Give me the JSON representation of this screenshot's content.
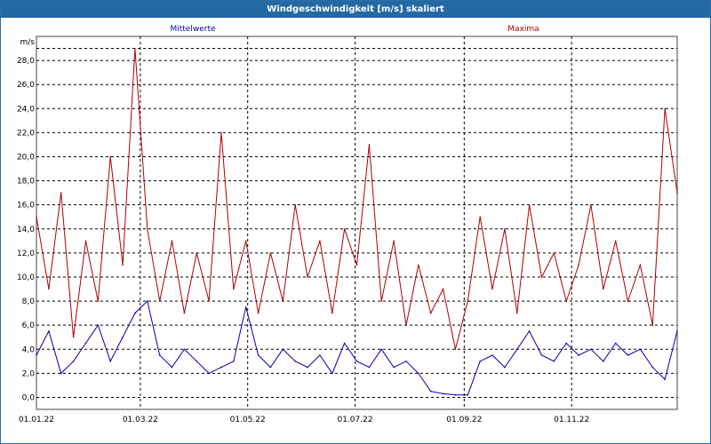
{
  "window": {
    "title": "Windgeschwindigkeit [m/s] skaliert"
  },
  "colors": {
    "mean": "#0000aa",
    "max": "#aa0000",
    "grid": "#000000",
    "title_bar": "#2369a3"
  },
  "chart_data": {
    "type": "line",
    "ylabel": "m/s",
    "ylim": [
      -1,
      30
    ],
    "yticks": [
      "0,0",
      "2,0",
      "4,0",
      "6,0",
      "8,0",
      "10,0",
      "12,0",
      "14,0",
      "16,0",
      "18,0",
      "20,0",
      "22,0",
      "24,0",
      "26,0",
      "28,0"
    ],
    "xlim": [
      "2022-01-01",
      "2022-12-31"
    ],
    "xticks": [
      "01.01.22",
      "01.03.22",
      "01.05.22",
      "01.07.22",
      "01.09.22",
      "01.11.22"
    ],
    "grid": true,
    "legend_placement": "top",
    "series": [
      {
        "name": "Mittelwerte",
        "color": "#0000aa",
        "x": [
          "2022-01-01",
          "2022-01-08",
          "2022-01-15",
          "2022-01-22",
          "2022-01-29",
          "2022-02-05",
          "2022-02-12",
          "2022-02-19",
          "2022-02-26",
          "2022-03-05",
          "2022-03-12",
          "2022-03-19",
          "2022-03-26",
          "2022-04-02",
          "2022-04-09",
          "2022-04-16",
          "2022-04-23",
          "2022-04-30",
          "2022-05-07",
          "2022-05-14",
          "2022-05-21",
          "2022-05-28",
          "2022-06-04",
          "2022-06-11",
          "2022-06-18",
          "2022-06-25",
          "2022-07-02",
          "2022-07-09",
          "2022-07-16",
          "2022-07-23",
          "2022-07-30",
          "2022-08-06",
          "2022-08-13",
          "2022-08-20",
          "2022-08-27",
          "2022-09-03",
          "2022-09-10",
          "2022-09-17",
          "2022-09-24",
          "2022-10-01",
          "2022-10-08",
          "2022-10-15",
          "2022-10-22",
          "2022-10-29",
          "2022-11-05",
          "2022-11-12",
          "2022-11-19",
          "2022-11-26",
          "2022-12-03",
          "2022-12-10",
          "2022-12-17",
          "2022-12-24",
          "2022-12-31"
        ],
        "values": [
          3.5,
          5.5,
          2.0,
          3.0,
          4.5,
          6.0,
          3.0,
          5.0,
          7.0,
          8.0,
          3.5,
          2.5,
          4.0,
          3.0,
          2.0,
          2.5,
          3.0,
          7.5,
          3.5,
          2.5,
          4.0,
          3.0,
          2.5,
          3.5,
          2.0,
          4.5,
          3.0,
          2.5,
          4.0,
          2.5,
          3.0,
          2.0,
          0.5,
          0.3,
          0.2,
          0.2,
          3.0,
          3.5,
          2.5,
          4.0,
          5.5,
          3.5,
          3.0,
          4.5,
          3.5,
          4.0,
          3.0,
          4.5,
          3.5,
          4.0,
          2.5,
          1.5,
          5.5
        ]
      },
      {
        "name": "Maxima",
        "color": "#aa0000",
        "x": [
          "2022-01-01",
          "2022-01-08",
          "2022-01-15",
          "2022-01-22",
          "2022-01-29",
          "2022-02-05",
          "2022-02-12",
          "2022-02-19",
          "2022-02-26",
          "2022-03-05",
          "2022-03-12",
          "2022-03-19",
          "2022-03-26",
          "2022-04-02",
          "2022-04-09",
          "2022-04-16",
          "2022-04-23",
          "2022-04-30",
          "2022-05-07",
          "2022-05-14",
          "2022-05-21",
          "2022-05-28",
          "2022-06-04",
          "2022-06-11",
          "2022-06-18",
          "2022-06-25",
          "2022-07-02",
          "2022-07-09",
          "2022-07-16",
          "2022-07-23",
          "2022-07-30",
          "2022-08-06",
          "2022-08-13",
          "2022-08-20",
          "2022-08-27",
          "2022-09-03",
          "2022-09-10",
          "2022-09-17",
          "2022-09-24",
          "2022-10-01",
          "2022-10-08",
          "2022-10-15",
          "2022-10-22",
          "2022-10-29",
          "2022-11-05",
          "2022-11-12",
          "2022-11-19",
          "2022-11-26",
          "2022-12-03",
          "2022-12-10",
          "2022-12-17",
          "2022-12-24",
          "2022-12-31"
        ],
        "values": [
          15.0,
          9.0,
          17.0,
          5.0,
          13.0,
          8.0,
          20.0,
          11.0,
          29.0,
          14.0,
          8.0,
          13.0,
          7.0,
          12.0,
          8.0,
          22.0,
          9.0,
          13.0,
          7.0,
          12.0,
          8.0,
          16.0,
          10.0,
          13.0,
          7.0,
          14.0,
          11.0,
          21.0,
          8.0,
          13.0,
          6.0,
          11.0,
          7.0,
          9.0,
          4.0,
          8.0,
          15.0,
          9.0,
          14.0,
          7.0,
          16.0,
          10.0,
          12.0,
          8.0,
          11.0,
          16.0,
          9.0,
          13.0,
          8.0,
          11.0,
          6.0,
          24.0,
          17.0
        ]
      }
    ]
  }
}
